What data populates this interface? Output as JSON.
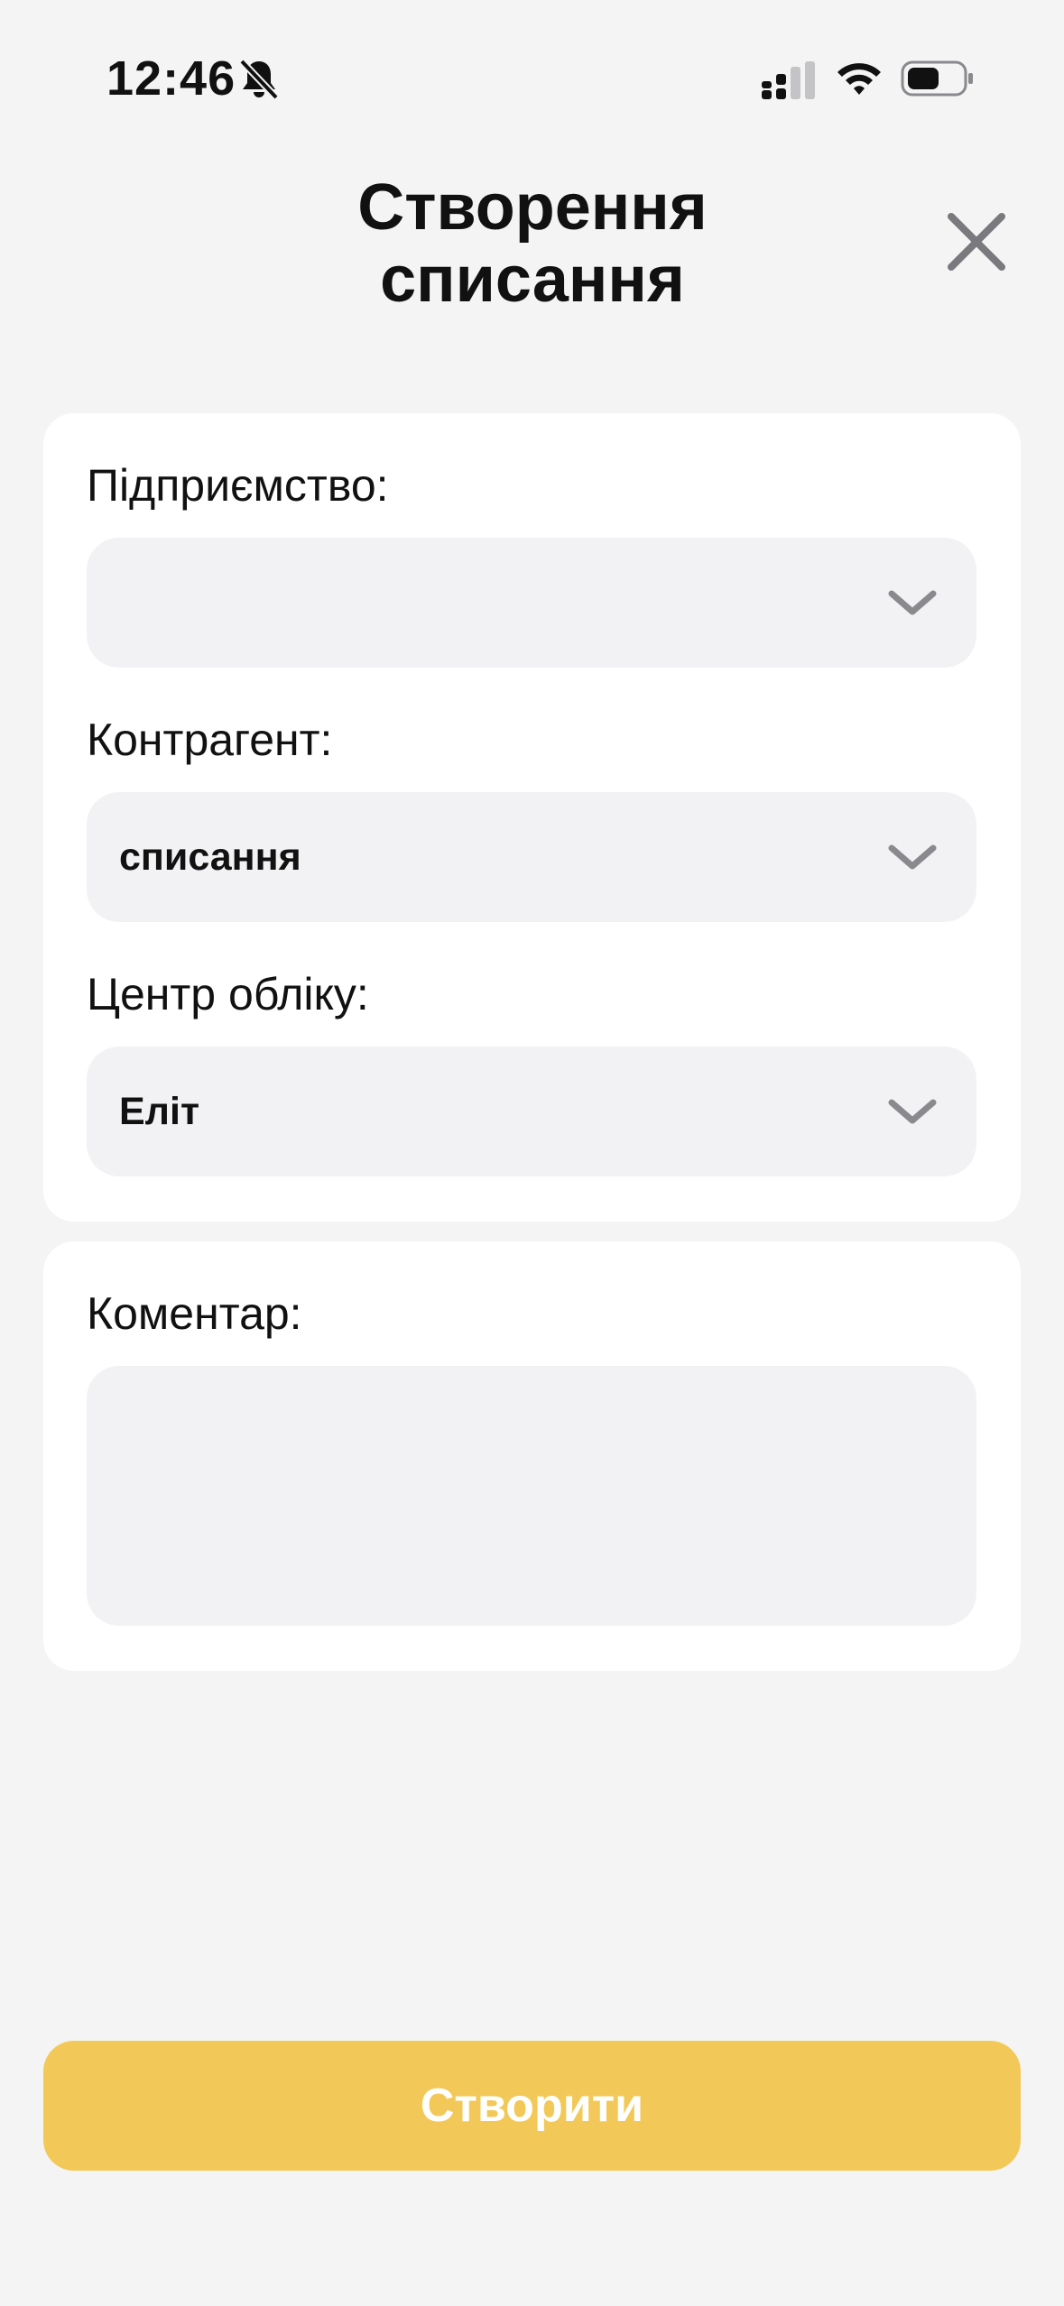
{
  "status_bar": {
    "time": "12:46",
    "icons": [
      "bell-muted-icon",
      "cellular-signal-icon",
      "wifi-icon",
      "battery-icon"
    ]
  },
  "header": {
    "title": "Створення\nсписання",
    "close_icon": "close-icon"
  },
  "form": {
    "enterprise": {
      "label": "Підприємство:",
      "value": ""
    },
    "counterparty": {
      "label": "Контрагент:",
      "value": "списання"
    },
    "accounting_center": {
      "label": "Центр обліку:",
      "value": "Еліт"
    },
    "comment": {
      "label": "Коментар:",
      "value": ""
    }
  },
  "actions": {
    "submit_label": "Створити"
  },
  "colors": {
    "background": "#f4f4f5",
    "card": "#ffffff",
    "field": "#f2f2f4",
    "accent": "#f2c958",
    "icon_gray": "#8a8a8e"
  }
}
